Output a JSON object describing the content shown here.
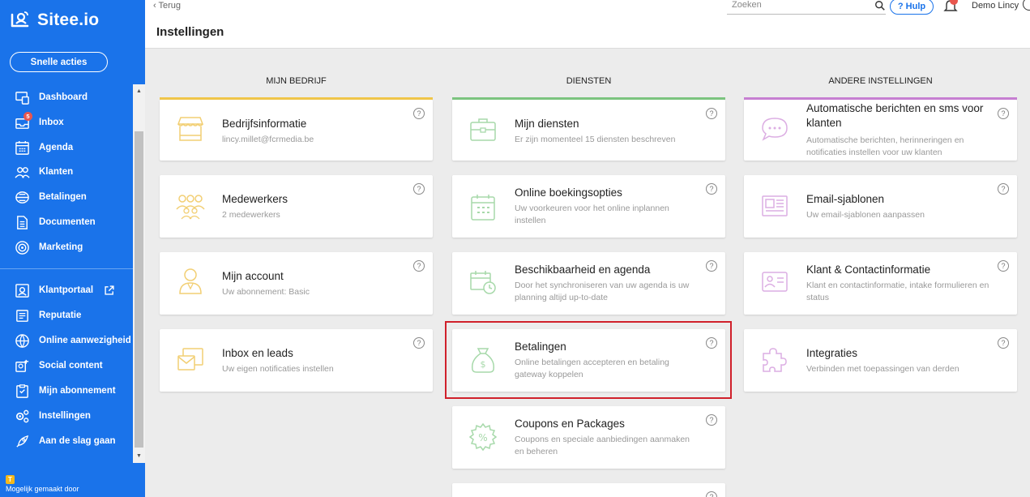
{
  "sidebar": {
    "logo": "Sitee.io",
    "quick_actions": "Snelle acties",
    "items": [
      {
        "label": "Dashboard",
        "icon": "dashboard-icon"
      },
      {
        "label": "Inbox",
        "icon": "inbox-icon",
        "badge": "5"
      },
      {
        "label": "Agenda",
        "icon": "calendar-icon"
      },
      {
        "label": "Klanten",
        "icon": "users-icon"
      },
      {
        "label": "Betalingen",
        "icon": "payments-icon"
      },
      {
        "label": "Documenten",
        "icon": "document-icon"
      },
      {
        "label": "Marketing",
        "icon": "target-icon"
      },
      {
        "label": "Klantportaal",
        "icon": "portal-icon"
      },
      {
        "label": "Reputatie",
        "icon": "reputation-icon"
      },
      {
        "label": "Online aanwezigheid",
        "icon": "globe-icon"
      },
      {
        "label": "Social content",
        "icon": "social-icon"
      },
      {
        "label": "Mijn abonnement",
        "icon": "subscription-icon"
      },
      {
        "label": "Instellingen",
        "icon": "settings-icon"
      },
      {
        "label": "Aan de slag gaan",
        "icon": "rocket-icon"
      }
    ],
    "made_by": "Mogelijk gemaakt door"
  },
  "topbar": {
    "back": "‹ Terug",
    "title": "Instellingen",
    "search_placeholder": "Zoeken",
    "help": "? Hulp",
    "user": "Demo Lincy"
  },
  "columns": [
    {
      "header": "MIJN BEDRIJF",
      "color": "#f0c64a",
      "icon_color": "#f2cf74",
      "cards": [
        {
          "title": "Bedrijfsinformatie",
          "subtitle": "lincy.millet@fcrmedia.be",
          "icon": "store-icon"
        },
        {
          "title": "Medewerkers",
          "subtitle": "2 medewerkers",
          "icon": "team-icon"
        },
        {
          "title": "Mijn account",
          "subtitle": "Uw abonnement: Basic",
          "icon": "account-icon"
        },
        {
          "title": "Inbox en leads",
          "subtitle": "Uw eigen notificaties instellen",
          "icon": "mail-icon"
        }
      ]
    },
    {
      "header": "DIENSTEN",
      "color": "#7cc47f",
      "icon_color": "#a7d9aa",
      "cards": [
        {
          "title": "Mijn diensten",
          "subtitle": "Er zijn momenteel 15 diensten beschreven",
          "icon": "briefcase-icon"
        },
        {
          "title": "Online boekingsopties",
          "subtitle": "Uw voorkeuren voor het online inplannen instellen",
          "icon": "booking-calendar-icon"
        },
        {
          "title": "Beschikbaarheid en agenda",
          "subtitle": "Door het synchroniseren van uw agenda is uw planning altijd up-to-date",
          "icon": "availability-icon"
        },
        {
          "title": "Betalingen",
          "subtitle": "Online betalingen accepteren en betaling gateway koppelen",
          "icon": "money-bag-icon"
        },
        {
          "title": "Coupons en Packages",
          "subtitle": "Coupons en speciale aanbiedingen aanmaken en beheren",
          "icon": "coupon-icon"
        }
      ]
    },
    {
      "header": "ANDERE INSTELLINGEN",
      "color": "#c77fd2",
      "icon_color": "#dcaee3",
      "cards": [
        {
          "title": "Automatische berichten en sms voor klanten",
          "subtitle": "Automatische berichten, herinneringen en notificaties instellen voor uw klanten",
          "icon": "chat-icon"
        },
        {
          "title": "Email-sjablonen",
          "subtitle": "Uw email-sjablonen aanpassen",
          "icon": "newsletter-icon"
        },
        {
          "title": "Klant & Contactinformatie",
          "subtitle": "Klant en contactinformatie, intake formulieren en status",
          "icon": "contact-card-icon"
        },
        {
          "title": "Integraties",
          "subtitle": "Verbinden met toepassingen van derden",
          "icon": "puzzle-icon"
        }
      ]
    }
  ],
  "help_glyph": "?"
}
